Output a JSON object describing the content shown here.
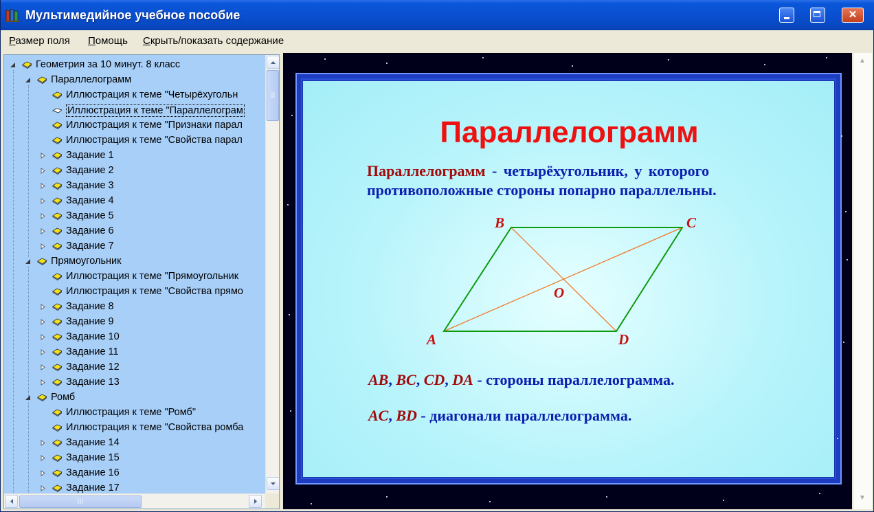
{
  "window": {
    "title": "Мультимедийное учебное пособие",
    "close_glyph": "✕"
  },
  "menu": {
    "items": [
      {
        "accel": "Р",
        "rest": "азмер поля"
      },
      {
        "accel": "П",
        "rest": "омощь"
      },
      {
        "accel": "С",
        "rest": "крыть/показать содержание"
      }
    ]
  },
  "tree": {
    "root": "Геометрия за 10 минут. 8 класс",
    "sections": [
      {
        "title": "Параллелограмм",
        "items": [
          "Иллюстрация к теме \"Четырёхугольн",
          "Иллюстрация к теме \"Параллелограм",
          "Иллюстрация к теме \"Признаки парал",
          "Иллюстрация к теме \"Свойства парал"
        ],
        "tasks": [
          "Задание 1",
          "Задание 2",
          "Задание 3",
          "Задание 4",
          "Задание 5",
          "Задание 6",
          "Задание 7"
        ]
      },
      {
        "title": "Прямоугольник",
        "items": [
          "Иллюстрация к теме \"Прямоугольник",
          "Иллюстрация к теме \"Свойства прямо"
        ],
        "tasks": [
          "Задание 8",
          "Задание 9",
          "Задание 10",
          "Задание 11",
          "Задание 12",
          "Задание 13"
        ]
      },
      {
        "title": "Ромб",
        "items": [
          "Иллюстрация к теме \"Ромб\"",
          "Иллюстрация к теме \"Свойства ромба"
        ],
        "tasks": [
          "Задание 14",
          "Задание 15",
          "Задание 16",
          "Задание 17"
        ]
      }
    ],
    "selected": "Иллюстрация к теме \"Параллелограм"
  },
  "slide": {
    "title": "Параллелограмм",
    "definition_term": "Параллелограмм",
    "definition_rest1": " - четырёхугольник, у которого",
    "definition_line2": "противоположные стороны попарно параллельны.",
    "vertices": {
      "A": "A",
      "B": "B",
      "C": "C",
      "D": "D",
      "O": "O"
    },
    "sides_list": [
      "AB",
      "BC",
      "CD",
      "DA"
    ],
    "sides_caption": " - стороны параллелограмма.",
    "diag_list": [
      "AC",
      "BD"
    ],
    "diag_caption": " - диагонали параллелограмма.",
    "colors": {
      "sides": "#0e9a0e",
      "diagonals": "#f07a2a",
      "title": "#ee1111"
    }
  }
}
